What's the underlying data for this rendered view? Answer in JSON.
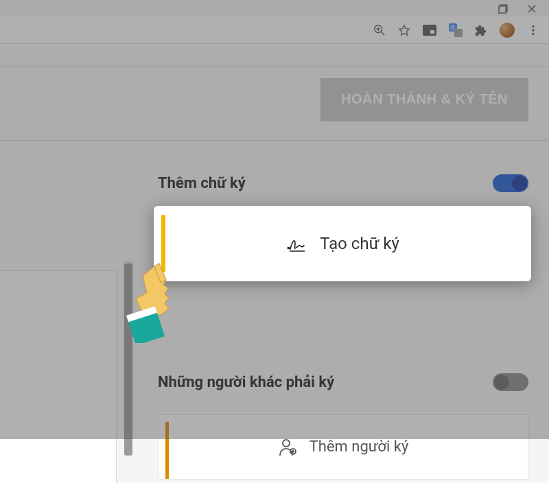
{
  "window": {},
  "toolbar": {},
  "actions": {
    "complete_label": "HOÀN THÀNH & KÝ TÊN"
  },
  "signature": {
    "title": "Thêm chữ ký",
    "toggle_on": true,
    "create_label": "Tạo chữ ký"
  },
  "others": {
    "title": "Những người khác phải ký",
    "toggle_on": false,
    "add_label": "Thêm người ký"
  }
}
